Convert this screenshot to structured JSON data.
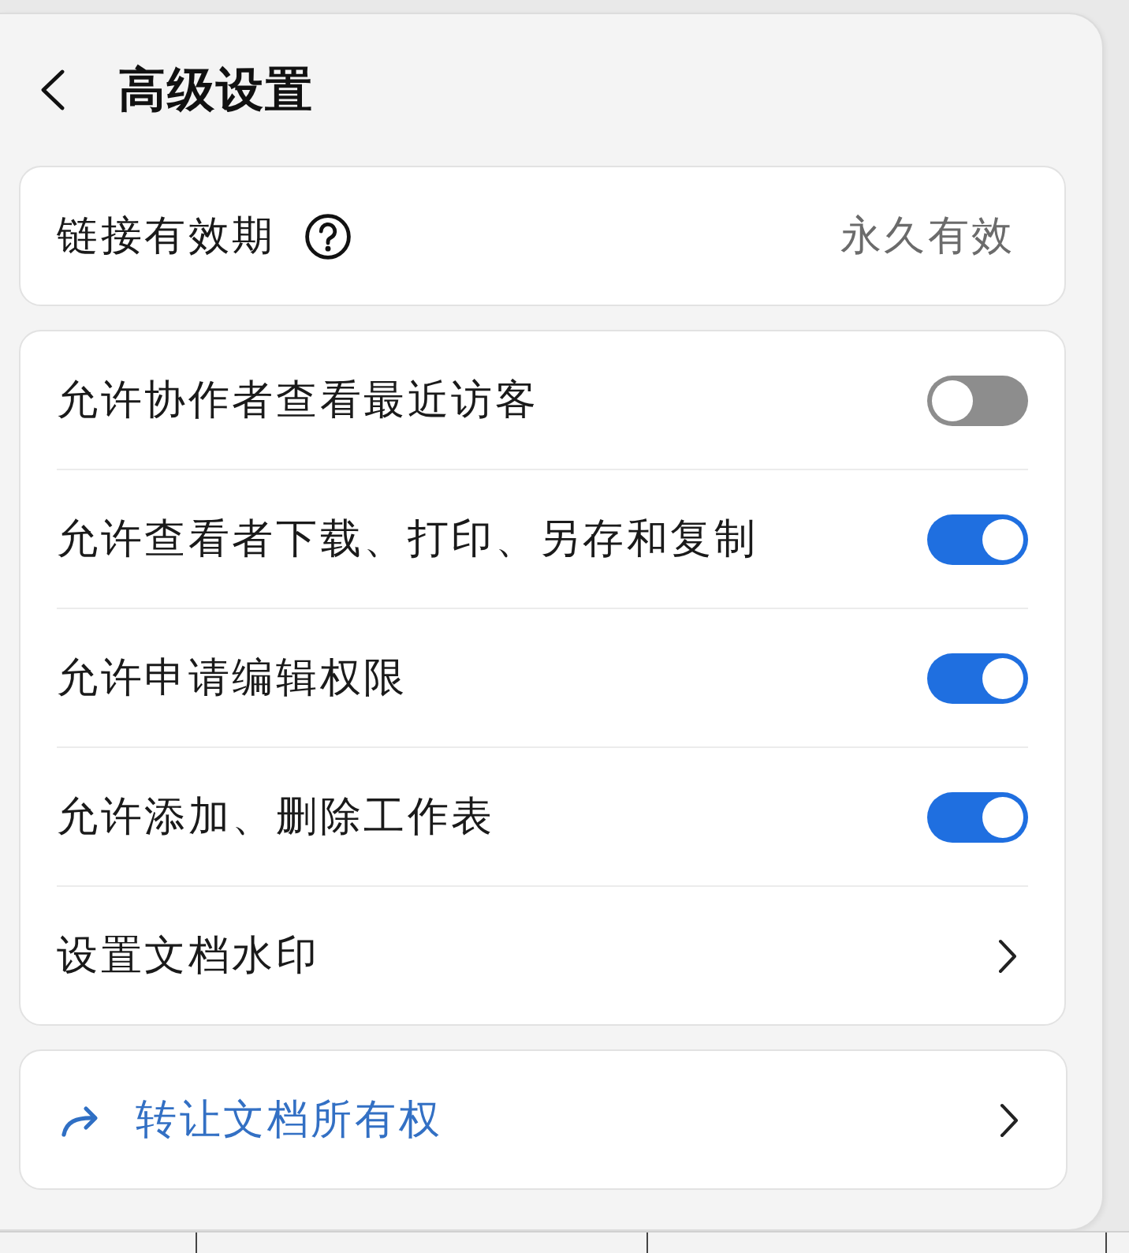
{
  "header": {
    "title": "高级设置"
  },
  "expiry": {
    "label": "链接有效期",
    "value": "永久有效"
  },
  "settings": [
    {
      "kind": "toggle",
      "label": "允许协作者查看最近访客",
      "on": false
    },
    {
      "kind": "toggle",
      "label": "允许查看者下载、打印、另存和复制",
      "on": true
    },
    {
      "kind": "toggle",
      "label": "允许申请编辑权限",
      "on": true
    },
    {
      "kind": "toggle",
      "label": "允许添加、删除工作表",
      "on": true
    },
    {
      "kind": "link",
      "label": "设置文档水印"
    }
  ],
  "transfer": {
    "label": "转让文档所有权"
  }
}
